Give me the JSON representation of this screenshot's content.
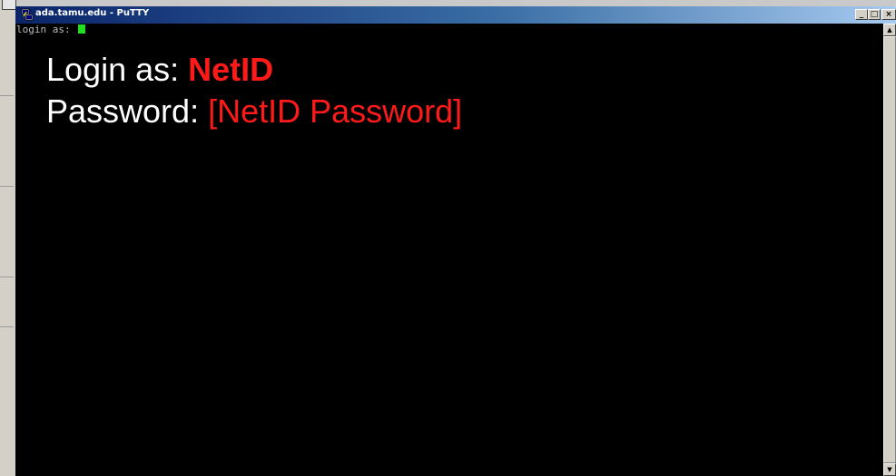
{
  "window": {
    "title": "ada.tamu.edu - PuTTY",
    "controls": {
      "minimize": "_",
      "maximize": "□",
      "close": "×"
    }
  },
  "terminal": {
    "prompt": "login as: ",
    "cursor_color": "#22dd22"
  },
  "overlay": {
    "login_label": "Login as: ",
    "login_value": "NetID",
    "password_label": "Password: ",
    "password_value": "[NetID Password]",
    "accent_color": "#ff1a1a"
  },
  "scrollbar": {
    "up_icon": "▲",
    "down_icon": "▼"
  }
}
